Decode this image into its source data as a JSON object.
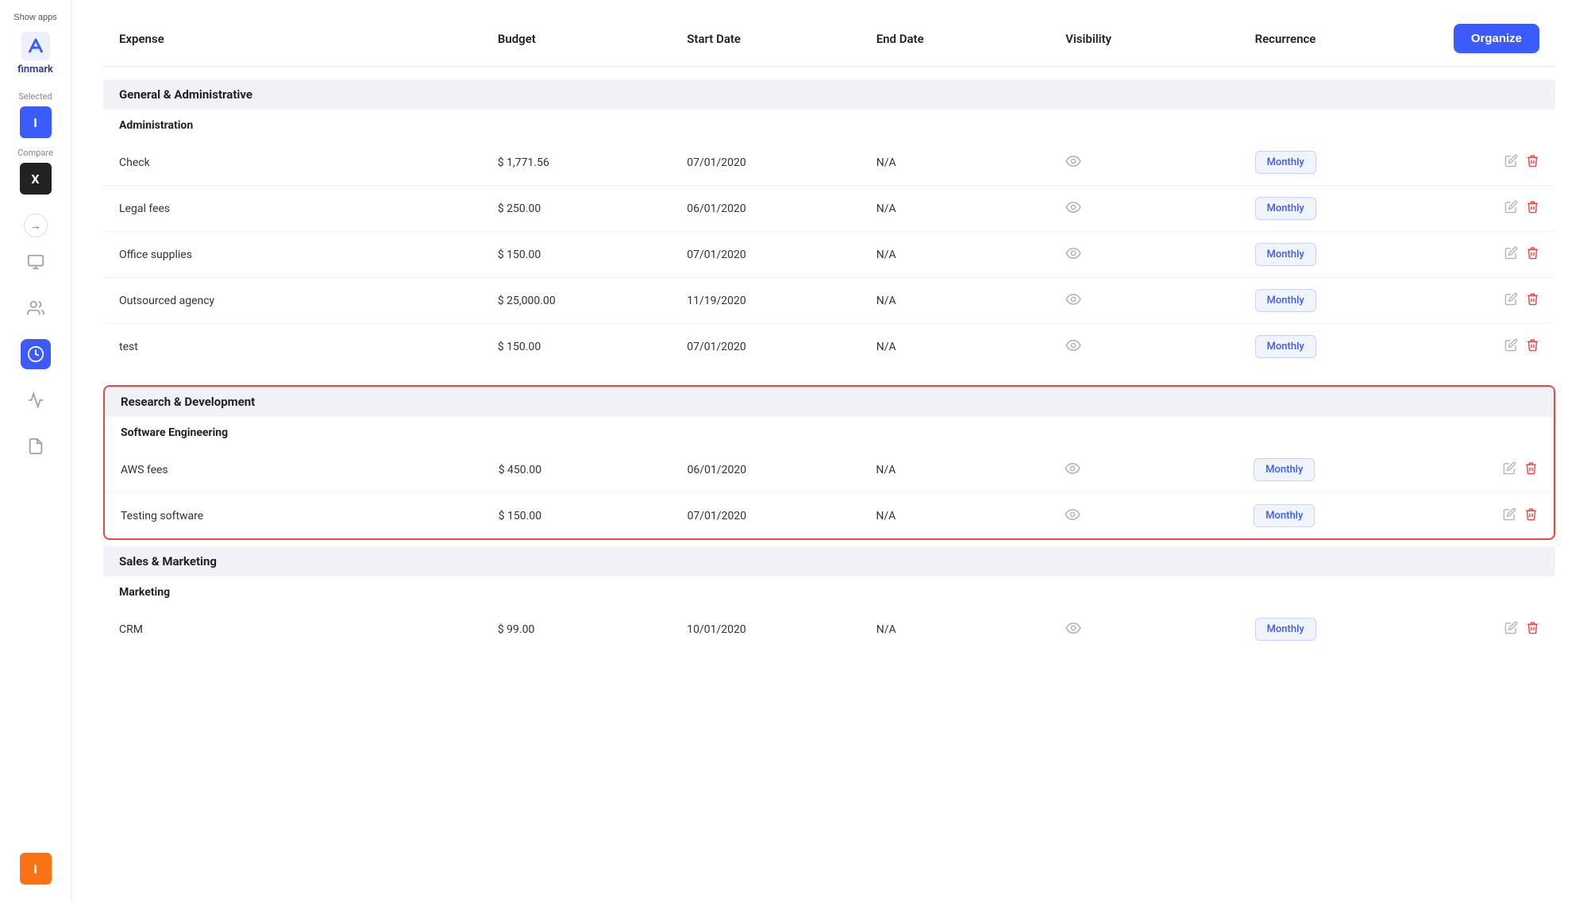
{
  "app": {
    "name": "finmark",
    "show_apps_label": "Show apps",
    "organize_label": "Organize"
  },
  "sidebar": {
    "selected_label": "Selected",
    "selected_avatar": "I",
    "compare_label": "Compare",
    "compare_avatar": "X",
    "user_avatar": "I"
  },
  "table": {
    "columns": [
      "Expense",
      "Budget",
      "Start Date",
      "End Date",
      "Visibility",
      "Recurrence",
      ""
    ],
    "sections": [
      {
        "id": "general-admin",
        "title": "General & Administrative",
        "highlighted": false,
        "subsections": [
          {
            "id": "administration",
            "title": "Administration",
            "rows": [
              {
                "expense": "Check",
                "budget": "$ 1,771.56",
                "start_date": "07/01/2020",
                "end_date": "N/A",
                "recurrence": "Monthly"
              },
              {
                "expense": "Legal fees",
                "budget": "$ 250.00",
                "start_date": "06/01/2020",
                "end_date": "N/A",
                "recurrence": "Monthly"
              },
              {
                "expense": "Office supplies",
                "budget": "$ 150.00",
                "start_date": "07/01/2020",
                "end_date": "N/A",
                "recurrence": "Monthly"
              },
              {
                "expense": "Outsourced agency",
                "budget": "$ 25,000.00",
                "start_date": "11/19/2020",
                "end_date": "N/A",
                "recurrence": "Monthly"
              },
              {
                "expense": "test",
                "budget": "$ 150.00",
                "start_date": "07/01/2020",
                "end_date": "N/A",
                "recurrence": "Monthly"
              }
            ]
          }
        ]
      },
      {
        "id": "research-dev",
        "title": "Research & Development",
        "highlighted": true,
        "subsections": [
          {
            "id": "software-engineering",
            "title": "Software Engineering",
            "rows": [
              {
                "expense": "AWS fees",
                "budget": "$ 450.00",
                "start_date": "06/01/2020",
                "end_date": "N/A",
                "recurrence": "Monthly"
              },
              {
                "expense": "Testing software",
                "budget": "$ 150.00",
                "start_date": "07/01/2020",
                "end_date": "N/A",
                "recurrence": "Monthly"
              }
            ]
          }
        ]
      },
      {
        "id": "sales-marketing",
        "title": "Sales & Marketing",
        "highlighted": false,
        "subsections": [
          {
            "id": "marketing",
            "title": "Marketing",
            "rows": [
              {
                "expense": "CRM",
                "budget": "$ 99.00",
                "start_date": "10/01/2020",
                "end_date": "N/A",
                "recurrence": "Monthly"
              }
            ]
          }
        ]
      }
    ]
  }
}
